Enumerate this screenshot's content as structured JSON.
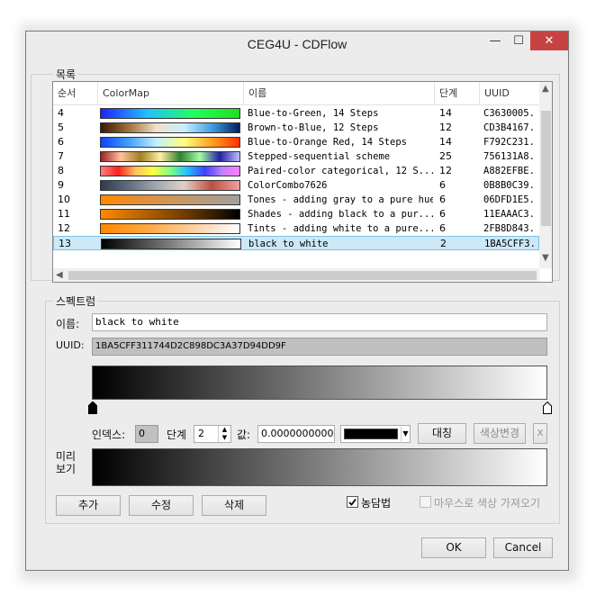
{
  "window": {
    "title": "CEG4U - CDFlow",
    "minimize_glyph": "—",
    "maximize_glyph": "☐",
    "close_glyph": "✕"
  },
  "list_group": {
    "label": "목록",
    "columns": [
      "순서",
      "ColorMap",
      "이름",
      "단계",
      "UUID"
    ],
    "rows": [
      {
        "order": "4",
        "name": "Blue-to-Green, 14 Steps",
        "steps": "14",
        "uuid": "C3630005.",
        "gradient": [
          "#2020ff",
          "#20c0ff",
          "#20ff60",
          "#20e020"
        ]
      },
      {
        "order": "5",
        "name": "Brown-to-Blue, 12 Steps",
        "steps": "12",
        "uuid": "CD3B4167.",
        "gradient": [
          "#3a1a00",
          "#a0703c",
          "#f0e0c8",
          "#c8f0ff",
          "#40a0e0",
          "#002060"
        ]
      },
      {
        "order": "6",
        "name": "Blue-to-Orange Red, 14 Steps",
        "steps": "14",
        "uuid": "F792C231.",
        "gradient": [
          "#1040ff",
          "#40a0ff",
          "#c0f0ff",
          "#ffff80",
          "#ffa020",
          "#ff3000"
        ]
      },
      {
        "order": "7",
        "name": "Stepped-sequential scheme",
        "steps": "25",
        "uuid": "756131A8.",
        "gradient": [
          "#a02020",
          "#ffc0a0",
          "#a08020",
          "#fff0a0",
          "#308030",
          "#a0ffa0",
          "#2020a0",
          "#c0c0ff"
        ]
      },
      {
        "order": "8",
        "name": "Paired-color categorical, 12 S...",
        "steps": "12",
        "uuid": "A882EFBE.",
        "gradient": [
          "#ff8080",
          "#ff2020",
          "#ffc060",
          "#ffff40",
          "#80ff80",
          "#20c0ff",
          "#4040ff",
          "#c080ff",
          "#ff80ff"
        ]
      },
      {
        "order": "9",
        "name": "ColorCombo7626",
        "steps": "6",
        "uuid": "0B8B0C39.",
        "gradient": [
          "#303a50",
          "#606c80",
          "#a0a8b0",
          "#e0d0c8",
          "#c05040",
          "#f0a0a0"
        ]
      },
      {
        "order": "10",
        "name": "Tones - adding gray to a pure hue",
        "steps": "6",
        "uuid": "06DFD1E5.",
        "gradient": [
          "#ff8800",
          "#e09040",
          "#c09a70",
          "#a0a0a0"
        ]
      },
      {
        "order": "11",
        "name": "Shades - adding black to a pur...",
        "steps": "6",
        "uuid": "11EAAAC3.",
        "gradient": [
          "#ff8800",
          "#b06000",
          "#603400",
          "#000000"
        ]
      },
      {
        "order": "12",
        "name": "Tints - adding white to a pure...",
        "steps": "6",
        "uuid": "2FB8D843.",
        "gradient": [
          "#ff8800",
          "#ffa840",
          "#ffd0a0",
          "#ffffff"
        ]
      },
      {
        "order": "13",
        "name": "black to white",
        "steps": "2",
        "uuid": "1BA5CFF3.",
        "gradient": [
          "#000000",
          "#ffffff"
        ],
        "selected": true
      }
    ]
  },
  "spectrum_group": {
    "label": "스펙트럼",
    "name_label": "이름:",
    "name_value": "black to white",
    "uuid_label": "UUID:",
    "uuid_value": "1BA5CFF311744D2C898DC3A37D94DD9F",
    "index_label": "인덱스:",
    "index_value": "0",
    "step_label": "단계",
    "step_value": "2",
    "value_label": "값:",
    "value_value": "0.0000000000",
    "color_swatch": "#000000",
    "symmetric_button": "대칭",
    "change_color_button": "색상변경",
    "x_button": "X",
    "preview_label_1": "미리",
    "preview_label_2": "보기",
    "add_button": "추가",
    "edit_button": "수정",
    "delete_button": "삭제",
    "shading_label": "농담법",
    "shading_checked": true,
    "mouse_pick_label": "마우스로 색상 가져오기",
    "mouse_pick_checked": false
  },
  "footer": {
    "ok_button": "OK",
    "cancel_button": "Cancel"
  }
}
